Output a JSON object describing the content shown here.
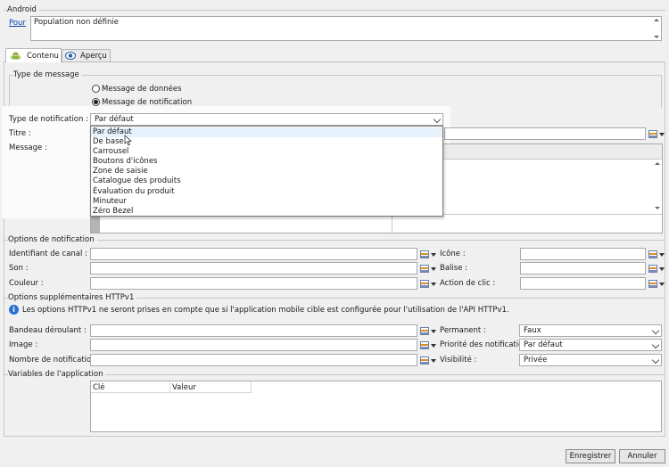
{
  "android": {
    "section_title": "Android",
    "pour_link": "Pour",
    "population_text": "Population non définie"
  },
  "tabs": [
    {
      "label": "Contenu",
      "icon": "android-icon"
    },
    {
      "label": "Aperçu",
      "icon": "eye-icon"
    }
  ],
  "message_type": {
    "section_title": "Type de message",
    "options": [
      "Message de données",
      "Message de notification"
    ],
    "selected": "Message de notification"
  },
  "notification": {
    "type_label": "Type de notification :",
    "type_value": "Par défaut",
    "title_label": "Titre :",
    "message_label": "Message :",
    "dropdown_options": [
      "Par défaut",
      "De base",
      "Carrousel",
      "Boutons d'icônes",
      "Zone de saisie",
      "Catalogue des produits",
      "Évaluation du produit",
      "Minuteur",
      "Zéro Bezel"
    ]
  },
  "notification_options": {
    "section_title": "Options de notification",
    "channel_label": "Identifiant de canal :",
    "sound_label": "Son :",
    "color_label": "Couleur :",
    "icon_label": "Icône :",
    "tag_label": "Balise :",
    "click_action_label": "Action de clic :"
  },
  "httpv1": {
    "section_title": "Options supplémentaires HTTPv1",
    "info_text": "Les options HTTPv1 ne seront prises en compte que si l'application mobile cible est configurée pour l'utilisation de l'API HTTPv1.",
    "banner_label": "Bandeau déroulant :",
    "image_label": "Image :",
    "count_label": "Nombre de notifications :",
    "permanent_label": "Permanent :",
    "permanent_value": "Faux",
    "priority_label": "Priorité des notifications :",
    "priority_value": "Par défaut",
    "visibility_label": "Visibilité :",
    "visibility_value": "Privée"
  },
  "app_vars": {
    "section_title": "Variables de l'application",
    "col_key": "Clé",
    "col_value": "Valeur"
  },
  "footer": {
    "save_label": "Enregistrer",
    "cancel_label": "Annuler"
  }
}
